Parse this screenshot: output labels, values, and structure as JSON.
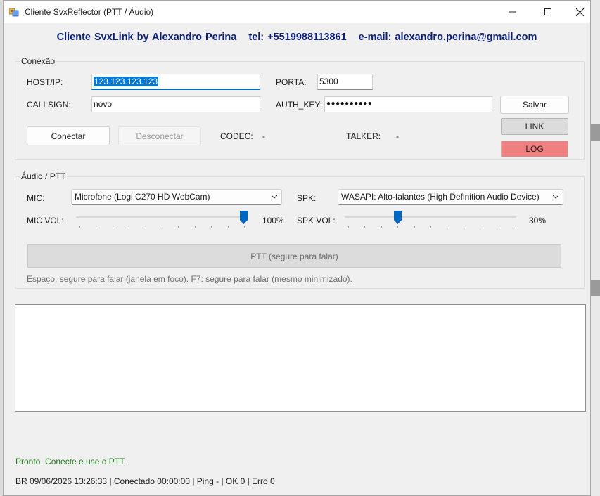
{
  "window": {
    "title": "Cliente SvxReflector (PTT / Áudio)",
    "controls": [
      "minimize-icon",
      "maximize-icon",
      "close-icon"
    ]
  },
  "header": {
    "name": "Cliente SvxLink by Alexandro Perina",
    "tel": "tel: +5519988113861",
    "email": "e-mail: alexandro.perina@gmail.com"
  },
  "conexao": {
    "group_label": "Conexão",
    "host_label": "HOST/IP:",
    "host_value": "123.123.123.123",
    "porta_label": "PORTA:",
    "porta_value": "5300",
    "callsign_label": "CALLSIGN:",
    "callsign_value": "novo",
    "auth_label": "AUTH_KEY:",
    "auth_value": "●●●●●●●●●●",
    "connect_label": "Conectar",
    "disconnect_label": "Desconectar",
    "codec_label": "CODEC:",
    "codec_value": "-",
    "talker_label": "TALKER:",
    "talker_value": "-",
    "save_label": "Salvar",
    "link_label": "LINK",
    "log_label": "LOG",
    "colors": {
      "link_bg": "#dcdcdc",
      "log_bg": "#f08080"
    }
  },
  "audio": {
    "group_label": "Áudio / PTT",
    "mic_label": "MIC:",
    "mic_value": "Microfone (Logi C270 HD WebCam)",
    "spk_label": "SPK:",
    "spk_value": "WASAPI: Alto-falantes (High Definition Audio Device)",
    "mic_vol_label": "MIC VOL:",
    "mic_vol_value": "100%",
    "mic_vol_level": 1.0,
    "spk_vol_label": "SPK VOL:",
    "spk_vol_value": "30%",
    "spk_vol_level": 0.3,
    "ptt_label": "PTT (segure para falar)",
    "hint": "Espaço: segure para falar (janela em foco).  F7: segure para falar (mesmo minimizado)."
  },
  "status": {
    "message": "Pronto. Conecte e use o PTT.",
    "message_color": "#1f7a1f",
    "bar": "BR 09/06/2026 13:26:33 | Conectado 00:00:00 | Ping - | OK 0 | Erro 0"
  }
}
